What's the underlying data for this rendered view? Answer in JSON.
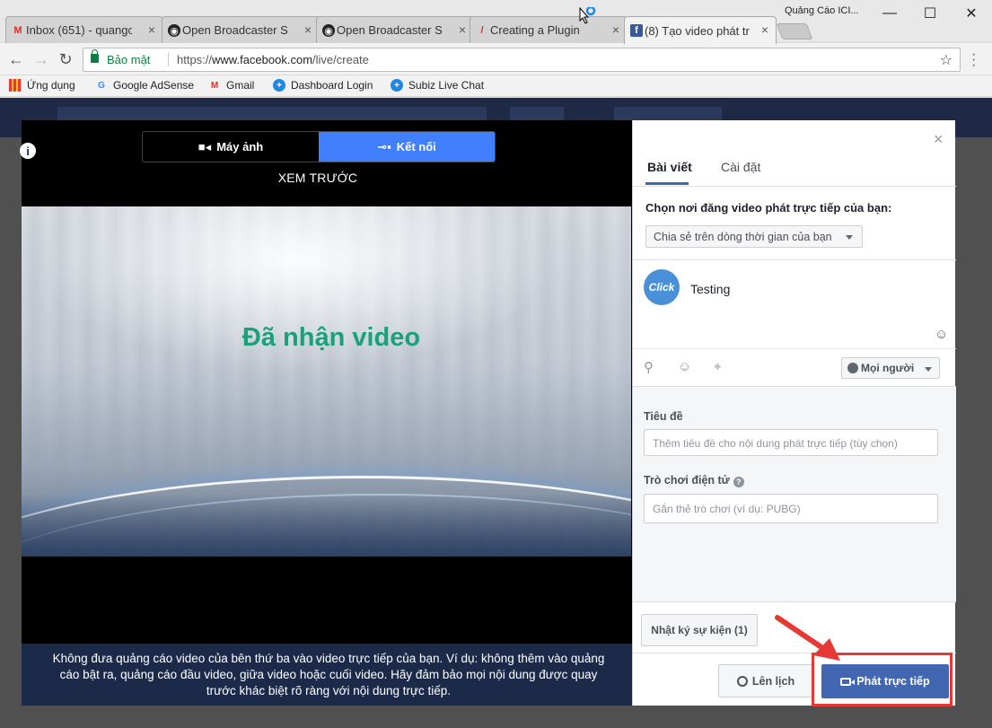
{
  "browser": {
    "tabs": [
      {
        "label": "Inbox (651) - quangc",
        "icon": "gmail-icon"
      },
      {
        "label": "Open Broadcaster Sc",
        "icon": "obs-icon"
      },
      {
        "label": "Open Broadcaster Sc",
        "icon": "obs-icon"
      },
      {
        "label": "Creating a Plugin",
        "icon": "feather-icon"
      },
      {
        "label": "(8) Tạo video phát tr",
        "icon": "facebook-icon"
      }
    ],
    "profile_label": "Quảng Cáo ICI...",
    "minimize": "—",
    "maximize": "☐",
    "close": "✕",
    "secure_label": "Bảo mật",
    "url_scheme": "https://",
    "url_host": "www.facebook.com",
    "url_path": "/live/create",
    "bookmarks": [
      {
        "label": "Ứng dụng",
        "icon": "apps-grid-icon"
      },
      {
        "label": "Google AdSense",
        "icon": "google-icon"
      },
      {
        "label": "Gmail",
        "icon": "gmail-icon"
      },
      {
        "label": "Dashboard Login",
        "icon": "plus-circle-icon"
      },
      {
        "label": "Subiz Live Chat",
        "icon": "plus-circle-icon"
      }
    ]
  },
  "live": {
    "toggle": {
      "camera": "Máy ảnh",
      "connect": "Kết nối",
      "active": "connect"
    },
    "preview_label": "XEM TRƯỚC",
    "video_status": "Đã nhận video",
    "notice": "Không đưa quảng cáo video của bên thứ ba vào video trực tiếp của bạn. Ví dụ: không thêm vào quảng cáo bật ra, quảng cáo đầu video, giữa video hoặc cuối video. Hãy đảm bảo mọi nội dung được quay trước khác biệt rõ ràng với nội dung trực tiếp."
  },
  "panel": {
    "close": "×",
    "tabs": [
      "Bài viết",
      "Cài đặt"
    ],
    "where_label": "Chọn nơi đăng video phát trực tiếp của bạn:",
    "where_value": "Chia sẻ trên dòng thời gian của bạn",
    "avatar_text": "Click",
    "post_text": "Testing",
    "audience": "Mọi người",
    "title_label": "Tiêu đề",
    "title_placeholder": "Thêm tiêu đề cho nội dung phát trực tiếp (tùy chọn)",
    "game_label": "Trò chơi điện tử",
    "game_placeholder": "Gắn thẻ trò chơi (ví dụ: PUBG)",
    "event_log": "Nhật ký sự kiện (1)",
    "schedule": "Lên lịch",
    "go_live": "Phát trực tiếp"
  },
  "colors": {
    "accent": "#4267b2",
    "toggle_on": "#4080ff",
    "status_green": "#1ba17a",
    "annotation_red": "#e53935"
  }
}
